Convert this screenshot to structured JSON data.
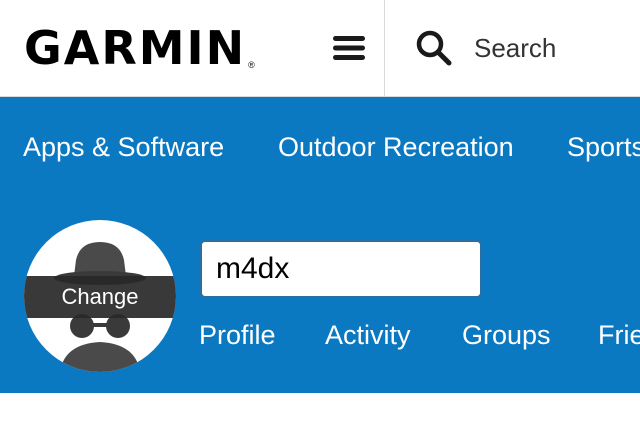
{
  "header": {
    "logo_text": "GARMIN",
    "logo_mark": "®",
    "menu_icon": "hamburger-icon",
    "search_icon": "search-icon",
    "search_placeholder": "Search"
  },
  "nav": {
    "items": [
      {
        "label": "Apps & Software"
      },
      {
        "label": "Outdoor Recreation"
      },
      {
        "label": "Sports"
      }
    ]
  },
  "profile": {
    "avatar_icon": "incognito-avatar-icon",
    "change_label": "Change",
    "username_value": "m4dx",
    "tabs": [
      {
        "label": "Profile"
      },
      {
        "label": "Activity"
      },
      {
        "label": "Groups"
      },
      {
        "label": "Friends"
      }
    ]
  },
  "colors": {
    "brand_blue": "#0b78c2",
    "header_bg": "#ffffff",
    "text_dark": "#000000"
  }
}
